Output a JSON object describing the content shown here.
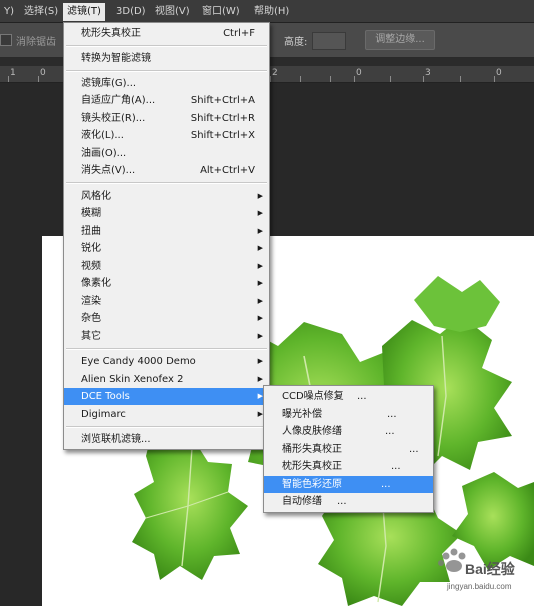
{
  "menubar": {
    "items": [
      {
        "label": "Y)",
        "active": false
      },
      {
        "label": "选择(S)",
        "active": false
      },
      {
        "label": "滤镜(T)",
        "active": true
      },
      {
        "label": "3D(D)",
        "active": false
      },
      {
        "label": "视图(V)",
        "active": false
      },
      {
        "label": "窗口(W)",
        "active": false
      },
      {
        "label": "帮助(H)",
        "active": false
      }
    ]
  },
  "options_bar": {
    "antialias_label": "消除锯齿",
    "height_label": "高度:",
    "height_value": "",
    "refine_edge_label": "调整边缘..."
  },
  "ruler": {
    "numbers": [
      "1",
      "0",
      "2",
      "0",
      "3",
      "0"
    ]
  },
  "filter_menu": {
    "items": [
      {
        "label": "枕形失真校正",
        "shortcut": "Ctrl+F"
      },
      {
        "label": "转换为智能滤镜"
      },
      {
        "label": "滤镜库(G)..."
      },
      {
        "label": "自适应广角(A)...",
        "shortcut": "Shift+Ctrl+A"
      },
      {
        "label": "镜头校正(R)...",
        "shortcut": "Shift+Ctrl+R"
      },
      {
        "label": "液化(L)...",
        "shortcut": "Shift+Ctrl+X"
      },
      {
        "label": "油画(O)..."
      },
      {
        "label": "消失点(V)...",
        "shortcut": "Alt+Ctrl+V"
      },
      {
        "label": "风格化",
        "submenu": true
      },
      {
        "label": "模糊",
        "submenu": true
      },
      {
        "label": "扭曲",
        "submenu": true
      },
      {
        "label": "锐化",
        "submenu": true
      },
      {
        "label": "视频",
        "submenu": true
      },
      {
        "label": "像素化",
        "submenu": true
      },
      {
        "label": "渲染",
        "submenu": true
      },
      {
        "label": "杂色",
        "submenu": true
      },
      {
        "label": "其它",
        "submenu": true
      },
      {
        "label": " Eye Candy 4000  Demo",
        "submenu": true
      },
      {
        "label": "Alien Skin Xenofex 2",
        "submenu": true
      },
      {
        "label": "DCE Tools",
        "submenu": true,
        "highlighted": true
      },
      {
        "label": "Digimarc",
        "submenu": true
      },
      {
        "label": "浏览联机滤镜..."
      }
    ]
  },
  "dce_submenu": {
    "items": [
      {
        "label": "CCD噪点修复",
        "ellipsis": "..."
      },
      {
        "label": "曝光补偿",
        "ellipsis": "..."
      },
      {
        "label": "人像皮肤修缮",
        "ellipsis": "..."
      },
      {
        "label": "桶形失真校正",
        "ellipsis": "..."
      },
      {
        "label": "枕形失真校正",
        "ellipsis": "..."
      },
      {
        "label": "智能色彩还原",
        "ellipsis": "...",
        "highlighted": true
      },
      {
        "label": "自动修缮",
        "ellipsis": "..."
      }
    ]
  },
  "watermark": {
    "text": "Bai经验",
    "sub": "jingyan.baidu.com"
  },
  "colors": {
    "highlight": "#3e8ff3",
    "leaf": "#5fb52b",
    "menu_bg": "#f0f0f0"
  }
}
